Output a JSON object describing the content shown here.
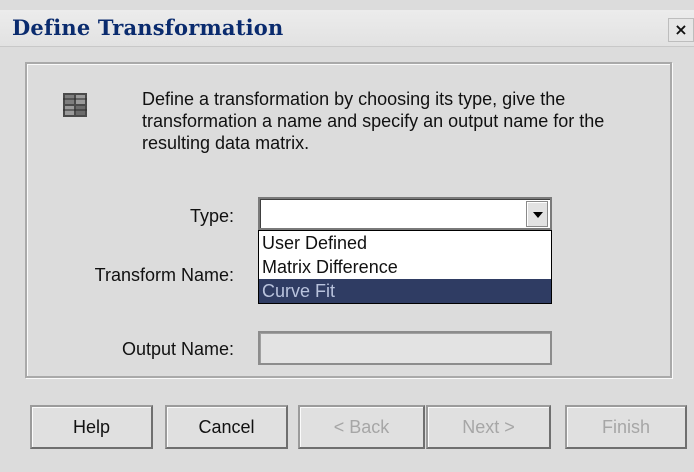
{
  "window": {
    "title": "Define Transformation",
    "close_label": "×"
  },
  "description": "Define a transformation by choosing its type, give the transformation a name and specify an output name for the resulting data matrix.",
  "form": {
    "type_label": "Type:",
    "type_value": "",
    "type_options": [
      "User Defined",
      "Matrix Difference",
      "Curve Fit"
    ],
    "type_highlighted": "Curve Fit",
    "transform_name_label": "Transform Name:",
    "output_name_label": "Output Name:",
    "output_name_value": ""
  },
  "buttons": {
    "help": "Help",
    "cancel": "Cancel",
    "back": "< Back",
    "next": "Next >",
    "finish": "Finish"
  },
  "icons": {
    "info": "data-matrix-icon"
  }
}
